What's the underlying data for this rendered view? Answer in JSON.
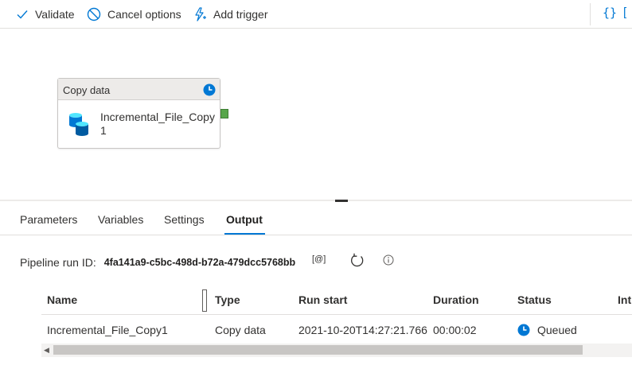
{
  "toolbar": {
    "validate_label": "Validate",
    "cancel_label": "Cancel options",
    "trigger_label": "Add trigger",
    "code_label": "{}",
    "extra_label": "["
  },
  "canvas": {
    "activity": {
      "type_label": "Copy data",
      "name": "Incremental_File_Copy1",
      "icon": "database-icon",
      "status_icon": "clock-icon"
    }
  },
  "tabs": [
    {
      "label": "Parameters"
    },
    {
      "label": "Variables"
    },
    {
      "label": "Settings"
    },
    {
      "label": "Output",
      "active": true
    }
  ],
  "output": {
    "run_id_label": "Pipeline run ID:",
    "run_id_value": "4fa141a9-c5bc-498d-b72a-479dcc5768bb",
    "copy_label": "[@]",
    "table": {
      "columns": [
        "Name",
        "Type",
        "Run start",
        "Duration",
        "Status",
        "Int"
      ],
      "rows": [
        {
          "name": "Incremental_File_Copy1",
          "type": "Copy data",
          "run_start": "2021-10-20T14:27:21.766",
          "duration": "00:00:02",
          "status": "Queued"
        }
      ]
    }
  },
  "colors": {
    "accent": "#0078d4",
    "status_queued": "#0078d4",
    "port": "#57a64a"
  }
}
